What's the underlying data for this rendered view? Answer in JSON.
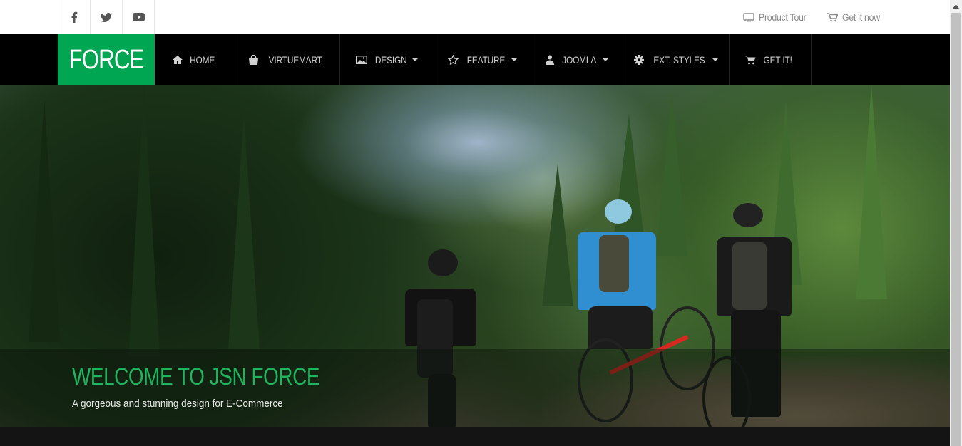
{
  "social": [
    {
      "name": "facebook",
      "glyph": "f"
    },
    {
      "name": "twitter",
      "glyph": "t"
    },
    {
      "name": "youtube",
      "glyph": "y"
    }
  ],
  "toplinks": {
    "product_tour": "Product Tour",
    "get_it_now": "Get it now"
  },
  "logo": "FORCE",
  "menu": [
    {
      "label": "HOME",
      "icon": "home-icon",
      "dropdown": false
    },
    {
      "label": "VIRTUEMART",
      "icon": "shopping-bag-icon",
      "dropdown": false
    },
    {
      "label": "DESIGN",
      "icon": "image-icon",
      "dropdown": true
    },
    {
      "label": "FEATURE",
      "icon": "star-icon",
      "dropdown": true
    },
    {
      "label": "JOOMLA",
      "icon": "user-icon",
      "dropdown": true
    },
    {
      "label": "EXT. STYLES",
      "icon": "gear-icon",
      "dropdown": true
    },
    {
      "label": "GET IT!",
      "icon": "cart-icon",
      "dropdown": false
    }
  ],
  "hero": {
    "title": "WELCOME TO JSN FORCE",
    "subtitle": "A gorgeous and stunning design for E-Commerce"
  },
  "colors": {
    "brand_green": "#00a652",
    "nav_bg": "#000000",
    "title_green": "#20b45f"
  }
}
